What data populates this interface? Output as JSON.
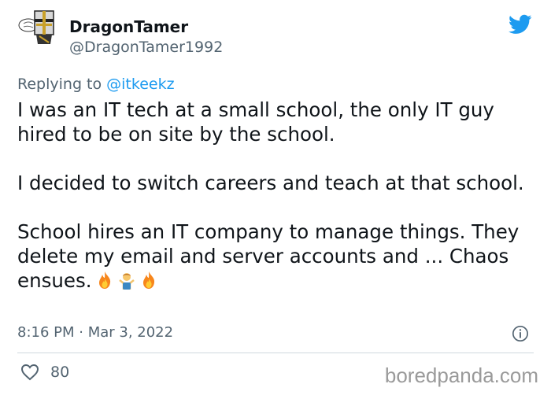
{
  "user": {
    "name": "DragonTamer",
    "handle": "@DragonTamer1992"
  },
  "reply": {
    "prefix": "Replying to ",
    "mention": "@itkeekz"
  },
  "tweet": {
    "paragraphs": [
      "I was an IT tech at a small school, the only IT guy hired to be on site by the school.",
      "I decided to switch careers and teach at that school.",
      "School hires an IT company to manage things. They delete my email and server accounts and ... Chaos ensues."
    ],
    "emojis": [
      "fire-emoji",
      "man-shrugging-emoji",
      "fire-emoji"
    ]
  },
  "meta": {
    "timestamp": "8:16 PM · Mar 3, 2022"
  },
  "likes": {
    "count": "80"
  },
  "watermark": "boredpanda.com",
  "colors": {
    "twitter_blue": "#1d9bf0",
    "secondary_text": "#536471",
    "divider": "#cfd9de",
    "heart": "#e0245e"
  },
  "icons": [
    "twitter-bird-icon",
    "info-icon",
    "heart-icon"
  ]
}
